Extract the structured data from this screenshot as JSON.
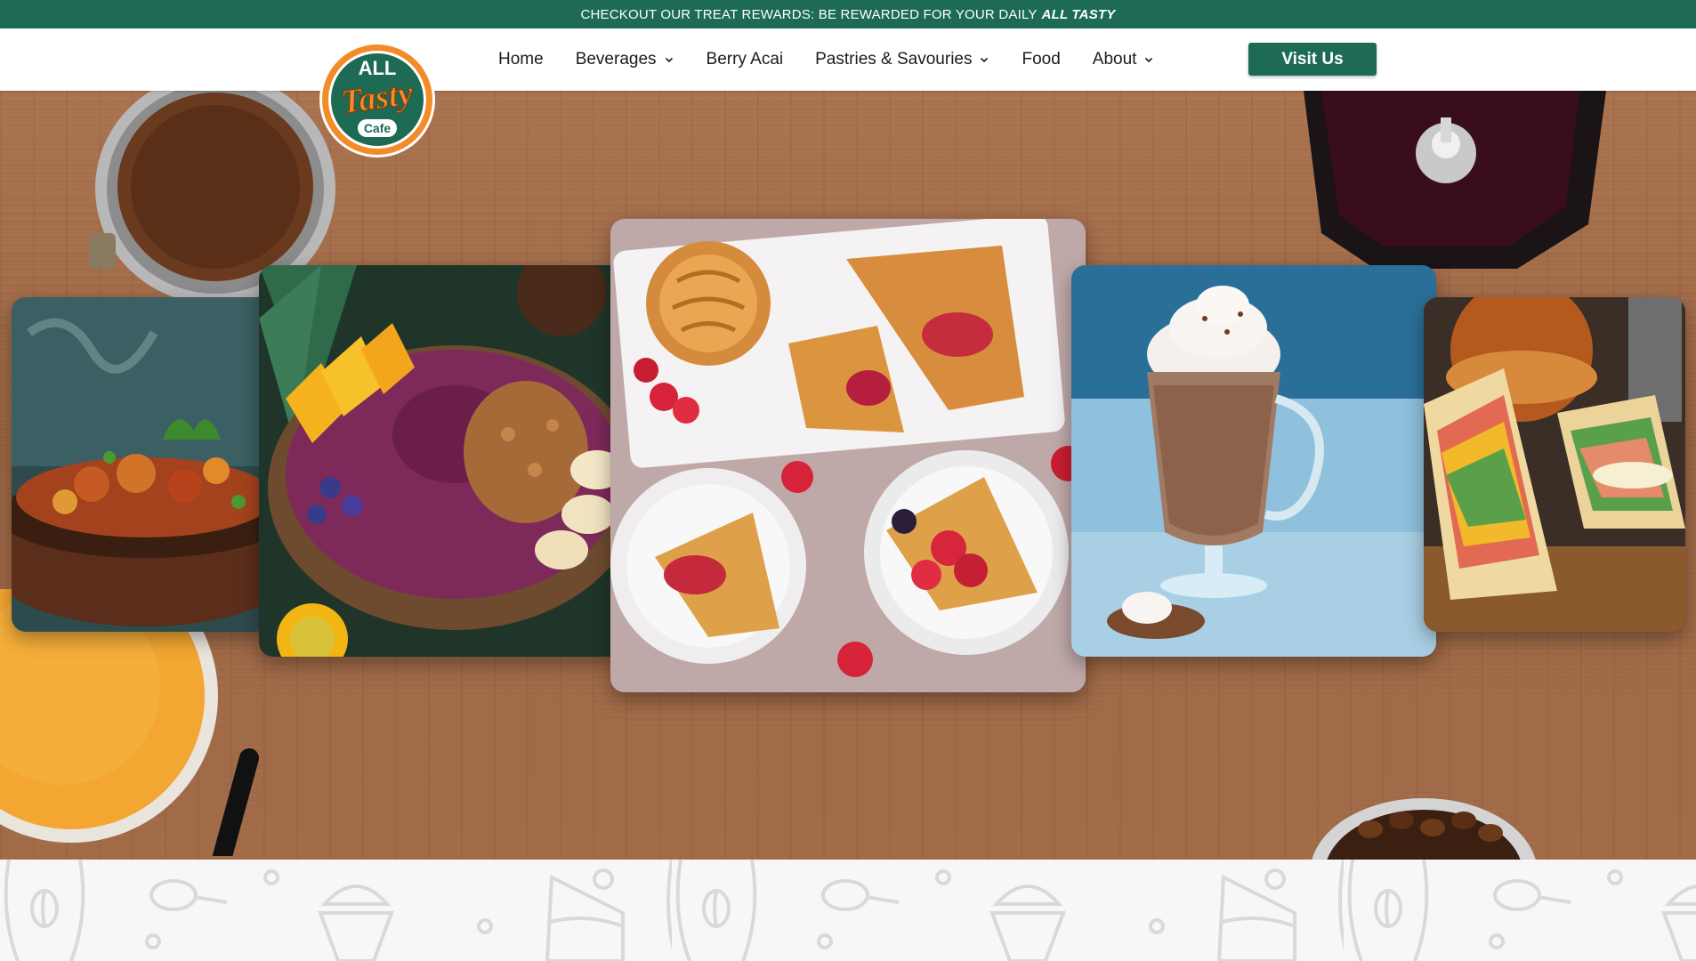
{
  "banner": {
    "text": "CHECKOUT OUR TREAT REWARDS: BE REWARDED FOR YOUR DAILY",
    "highlight": "ALL TASTY"
  },
  "logo": {
    "line1": "ALL",
    "line2": "Tasty",
    "line3": "Cafe"
  },
  "nav": {
    "items": [
      {
        "label": "Home",
        "dropdown": false
      },
      {
        "label": "Beverages",
        "dropdown": true
      },
      {
        "label": "Berry Acai",
        "dropdown": false
      },
      {
        "label": "Pastries & Savouries",
        "dropdown": true
      },
      {
        "label": "Food",
        "dropdown": false
      },
      {
        "label": "About",
        "dropdown": true
      }
    ],
    "cta_label": "Visit Us"
  },
  "colors": {
    "brand_green": "#1d6b55",
    "brand_orange": "#f28c28",
    "wood": "#a16b48"
  },
  "hero_images": [
    "roasted-vegetables",
    "acai-bowl",
    "croissant-pastries",
    "hot-chocolate",
    "club-sandwich"
  ]
}
